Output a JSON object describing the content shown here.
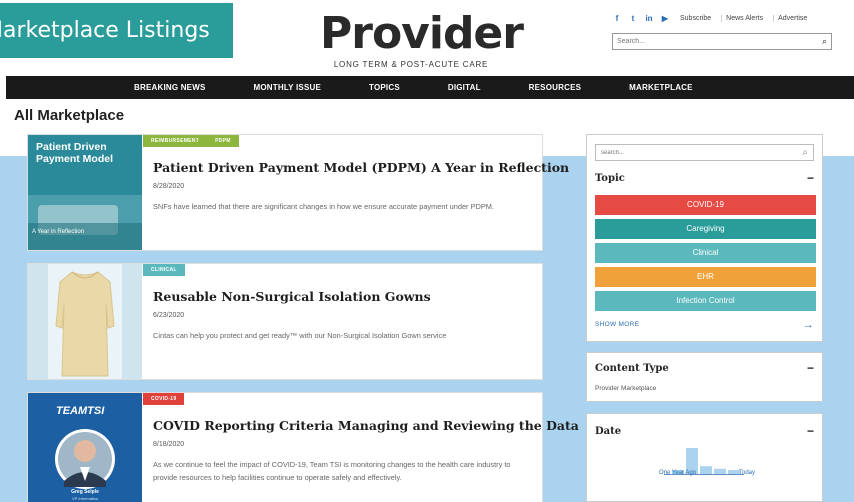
{
  "overlay": {
    "label": "Marketplace Listings"
  },
  "logo": {
    "title": "Provider",
    "subtitle": "LONG TERM & POST-ACUTE CARE"
  },
  "top_links": [
    "Subscribe",
    "News Alerts",
    "Advertise"
  ],
  "social": {
    "facebook": "f",
    "twitter": "t",
    "linkedin": "in",
    "youtube": "▶"
  },
  "top_search": {
    "placeholder": "Search...",
    "icon": "search-icon"
  },
  "nav": [
    "BREAKING NEWS",
    "MONTHLY ISSUE",
    "TOPICS",
    "DIGITAL",
    "RESOURCES",
    "MARKETPLACE"
  ],
  "page_title": "All Marketplace",
  "cards": [
    {
      "tags": [
        {
          "label": "REIMBURSEMENT",
          "color": "#8cb63c"
        },
        {
          "label": "PDPM",
          "color": "#8cb63c"
        }
      ],
      "title": "Patient Driven Payment Model (PDPM) A Year in Reflection",
      "date": "8/28/2020",
      "desc": "SNFs have learned that there are significant changes in how we ensure accurate payment under PDPM.",
      "image": {
        "heading": "Patient Driven Payment Model",
        "caption": "A Year in Reflection"
      }
    },
    {
      "tags": [
        {
          "label": "CLINICAL",
          "color": "#5bb8bd"
        }
      ],
      "title": "Reusable Non-Surgical Isolation Gowns",
      "date": "6/23/2020",
      "desc": "Cintas can help you protect and get ready™ with our Non-Surgical Isolation Gown service"
    },
    {
      "tags": [
        {
          "label": "COVID-19",
          "color": "#e0413b"
        }
      ],
      "title": "COVID Reporting Criteria Managing and Reviewing the Data",
      "date": "8/18/2020",
      "desc": "As we continue to feel the impact of COVID-19, Team TSI is monitoring changes to the health care industry to provide resources to help facilities continue to operate safely and effectively.",
      "image": {
        "logo": "TEAMTSI",
        "person": "Greg Seiple",
        "person_title": "VP Informatics"
      }
    }
  ],
  "sidebar": {
    "search_placeholder": "search...",
    "topic": {
      "label": "Topic",
      "items": [
        {
          "label": "COVID-19",
          "color": "#e54a44"
        },
        {
          "label": "Caregiving",
          "color": "#2a9d9b"
        },
        {
          "label": "Clinical",
          "color": "#5bb8bd"
        },
        {
          "label": "EHR",
          "color": "#f0a23a"
        },
        {
          "label": "Infection Control",
          "color": "#5bb8bd"
        }
      ],
      "show_more": "SHOW MORE"
    },
    "content_type": {
      "label": "Content Type",
      "value": "Provider Marketplace"
    },
    "date": {
      "label": "Date",
      "start_label": "One Year Ago",
      "end_label": "Today",
      "histogram": [
        0.15,
        1.0,
        0.3,
        0.2,
        0.15
      ]
    }
  }
}
